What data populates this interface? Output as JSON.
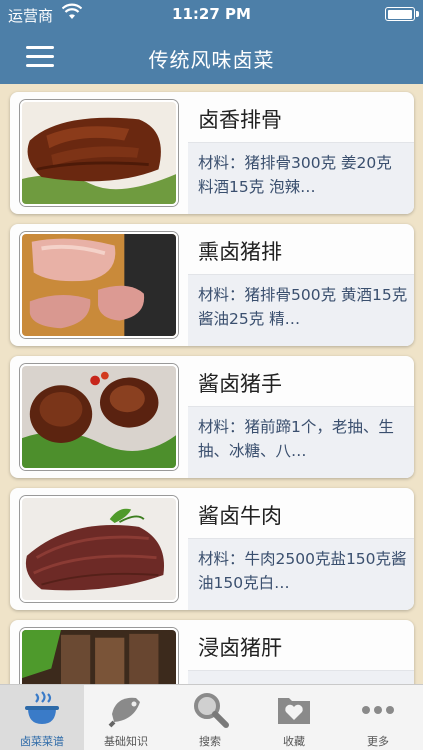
{
  "status_bar": {
    "carrier": "运营商",
    "time": "11:27 PM",
    "battery_level": 0.9
  },
  "nav": {
    "title": "传统风味卤菜",
    "menu_icon": "hamburger-icon"
  },
  "recipes": [
    {
      "name": "卤香排骨",
      "desc": "材料：猪排骨300克 姜20克 料酒15克 泡辣…",
      "image": "braised-ribs-photo"
    },
    {
      "name": "熏卤猪排",
      "desc": "材料：猪排骨500克 黄酒15克 酱油25克 精…",
      "image": "smoked-pork-chop-photo"
    },
    {
      "name": "酱卤猪手",
      "desc": "材料：猪前蹄1个，老抽、生抽、冰糖、八…",
      "image": "pork-trotter-photo"
    },
    {
      "name": "酱卤牛肉",
      "desc": "材料：牛肉2500克盐150克酱油150克白…",
      "image": "braised-beef-photo"
    },
    {
      "name": "浸卤猪肝",
      "desc": "",
      "image": "pork-liver-photo"
    }
  ],
  "tabs": [
    {
      "label": "卤菜菜谱",
      "icon": "pot-flame-icon",
      "active": true
    },
    {
      "label": "基础知识",
      "icon": "knife-icon",
      "active": false
    },
    {
      "label": "搜索",
      "icon": "magnifier-icon",
      "active": false
    },
    {
      "label": "收藏",
      "icon": "heart-folder-icon",
      "active": false
    },
    {
      "label": "更多",
      "icon": "more-dots-icon",
      "active": false
    }
  ],
  "colors": {
    "nav_bg": "#4d7fa8",
    "page_bg": "#efe3c8",
    "desc_text": "#3a4f6e",
    "tab_active": "#2d6aa8"
  }
}
